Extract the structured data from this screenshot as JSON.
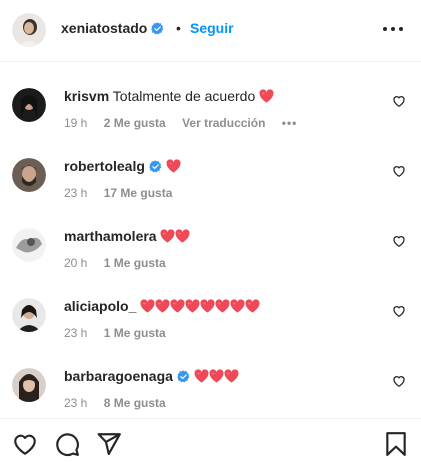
{
  "post": {
    "author": "xeniatostado",
    "separator": "•",
    "follow_label": "Seguir"
  },
  "comments": [
    {
      "user": "krisvm",
      "verified": false,
      "text": "Totalmente de acuerdo",
      "hearts": 1,
      "time": "19 h",
      "likes": "2 Me gusta",
      "translate": "Ver traducción",
      "more": "•••"
    },
    {
      "user": "robertolealg",
      "verified": true,
      "text": "",
      "hearts": 1,
      "time": "23 h",
      "likes": "17 Me gusta"
    },
    {
      "user": "marthamolera",
      "verified": false,
      "text": "",
      "hearts": 2,
      "time": "20 h",
      "likes": "1 Me gusta"
    },
    {
      "user": "aliciapolo_",
      "verified": false,
      "text": "",
      "hearts": 8,
      "time": "23 h",
      "likes": "1 Me gusta"
    },
    {
      "user": "barbaragoenaga",
      "verified": true,
      "text": "",
      "hearts": 3,
      "time": "23 h",
      "likes": "8 Me gusta"
    }
  ],
  "icons": {
    "like": "heart-outline-icon",
    "comment": "comment-bubble-icon",
    "share": "paper-plane-icon",
    "save": "bookmark-icon",
    "more": "more-horizontal-icon",
    "verified": "verified-badge-icon"
  },
  "colors": {
    "follow": "#0095f6",
    "verified": "#3897f0",
    "heart": "#ed4956",
    "meta": "#8e8e8e"
  }
}
